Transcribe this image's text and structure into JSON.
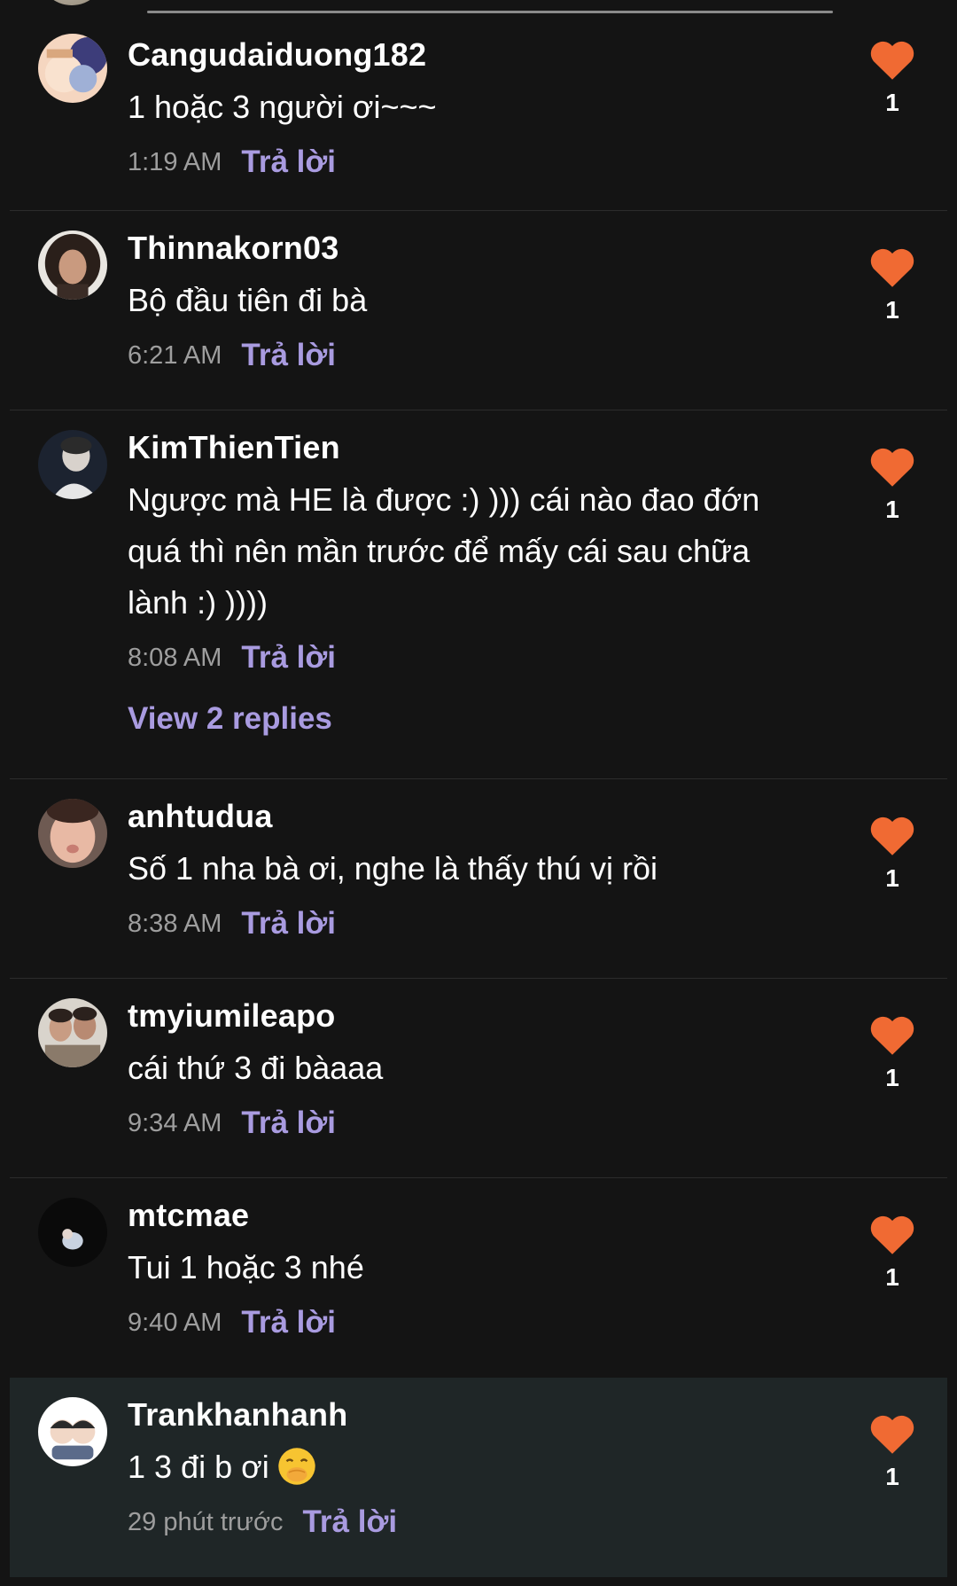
{
  "colors": {
    "background": "#141414",
    "highlight_background": "#1f2627",
    "accent": "#a99be0",
    "heart": "#f06a33",
    "timestamp": "#9e9e9e"
  },
  "comments": [
    {
      "username": "Cangudaiduong182",
      "text": "1 hoặc 3 người ơi~~~",
      "time": "1:19 AM",
      "reply": "Trả lời",
      "likes": "1",
      "avatar": "anime-pair-avatar"
    },
    {
      "username": "Thinnakorn03",
      "text": "Bộ đầu tiên đi bà",
      "time": "6:21 AM",
      "reply": "Trả lời",
      "likes": "1",
      "avatar": "curly-hair-avatar"
    },
    {
      "username": "KimThienTien",
      "text": "Ngược mà HE là được :) ))) cái nào đao đớn quá thì nên mần trước để mấy cái sau chữa lành :) ))))",
      "time": "8:08 AM",
      "reply": "Trả lời",
      "likes": "1",
      "view_replies": "View 2 replies",
      "avatar": "portrait-avatar"
    },
    {
      "username": "anhtudua",
      "text": "Số 1 nha bà ơi, nghe là thấy thú vị rồi",
      "time": "8:38 AM",
      "reply": "Trả lời",
      "likes": "1",
      "avatar": "selfie-avatar"
    },
    {
      "username": "tmyiumileapo",
      "text": "cái thứ 3 đi bàaaa",
      "time": "9:34 AM",
      "reply": "Trả lời",
      "likes": "1",
      "avatar": "two-people-avatar"
    },
    {
      "username": "mtcmae",
      "text": "Tui 1 hoặc 3 nhé",
      "time": "9:40 AM",
      "reply": "Trả lời",
      "likes": "1",
      "avatar": "dark-avatar"
    },
    {
      "username": "Trankhanhanh",
      "text": "1 3 đi b ơi",
      "emoji": "face-with-hand-over-mouth",
      "time": "29 phút trước",
      "reply": "Trả lời",
      "likes": "1",
      "avatar": "cartoon-avatar"
    }
  ]
}
